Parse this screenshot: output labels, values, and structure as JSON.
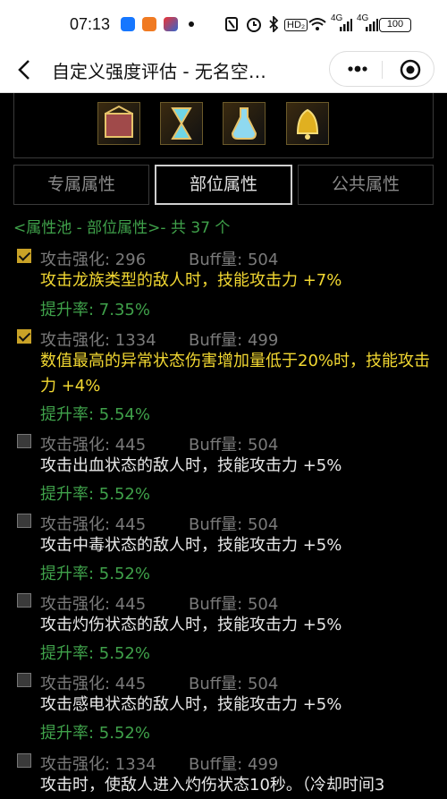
{
  "status_bar": {
    "time": "07:13",
    "left_icons": [
      "alipay-app-icon",
      "orange-app-icon",
      "colorful-app-icon"
    ],
    "right_icons": [
      "nfc-icon",
      "alarm-icon",
      "bluetooth-icon",
      "hd-icon",
      "wifi-icon",
      "signal-4g-icon",
      "signal-4g-icon"
    ],
    "hd_label": "HD₂",
    "signal_label": "4G",
    "battery": "100"
  },
  "nav": {
    "title": "自定义强度评估 - 无名空…"
  },
  "tabs": [
    {
      "label": "专属属性",
      "active": false
    },
    {
      "label": "部位属性",
      "active": true
    },
    {
      "label": "公共属性",
      "active": false
    }
  ],
  "pool_header": "<属性池 - 部位属性>- 共 37 个",
  "items": [
    {
      "checked": true,
      "stat": "攻击强化: 296",
      "buff": "Buff量: 504",
      "desc": "攻击龙族类型的敌人时，技能攻击力 +7%",
      "highlight": true,
      "rate": "提升率:  7.35%"
    },
    {
      "checked": true,
      "stat": "攻击强化: 1334",
      "buff": "Buff量: 499",
      "desc": "数值最高的异常状态伤害增加量低于20%时，技能攻击力 +4%",
      "highlight": true,
      "rate": "提升率:  5.54%"
    },
    {
      "checked": false,
      "stat": "攻击强化: 445",
      "buff": "Buff量: 504",
      "desc": "攻击出血状态的敌人时，技能攻击力 +5%",
      "highlight": false,
      "rate": "提升率:  5.52%"
    },
    {
      "checked": false,
      "stat": "攻击强化: 445",
      "buff": "Buff量: 504",
      "desc": "攻击中毒状态的敌人时，技能攻击力 +5%",
      "highlight": false,
      "rate": "提升率:  5.52%"
    },
    {
      "checked": false,
      "stat": "攻击强化: 445",
      "buff": "Buff量: 504",
      "desc": "攻击灼伤状态的敌人时，技能攻击力 +5%",
      "highlight": false,
      "rate": "提升率:  5.52%"
    },
    {
      "checked": false,
      "stat": "攻击强化: 445",
      "buff": "Buff量: 504",
      "desc": "攻击感电状态的敌人时，技能攻击力 +5%",
      "highlight": false,
      "rate": "提升率:  5.52%"
    },
    {
      "checked": false,
      "stat": "攻击强化: 1334",
      "buff": "Buff量: 499",
      "desc": "攻击时，使敌人进入灼伤状态10秒。（冷却时间3",
      "highlight": false,
      "rate": ""
    }
  ]
}
